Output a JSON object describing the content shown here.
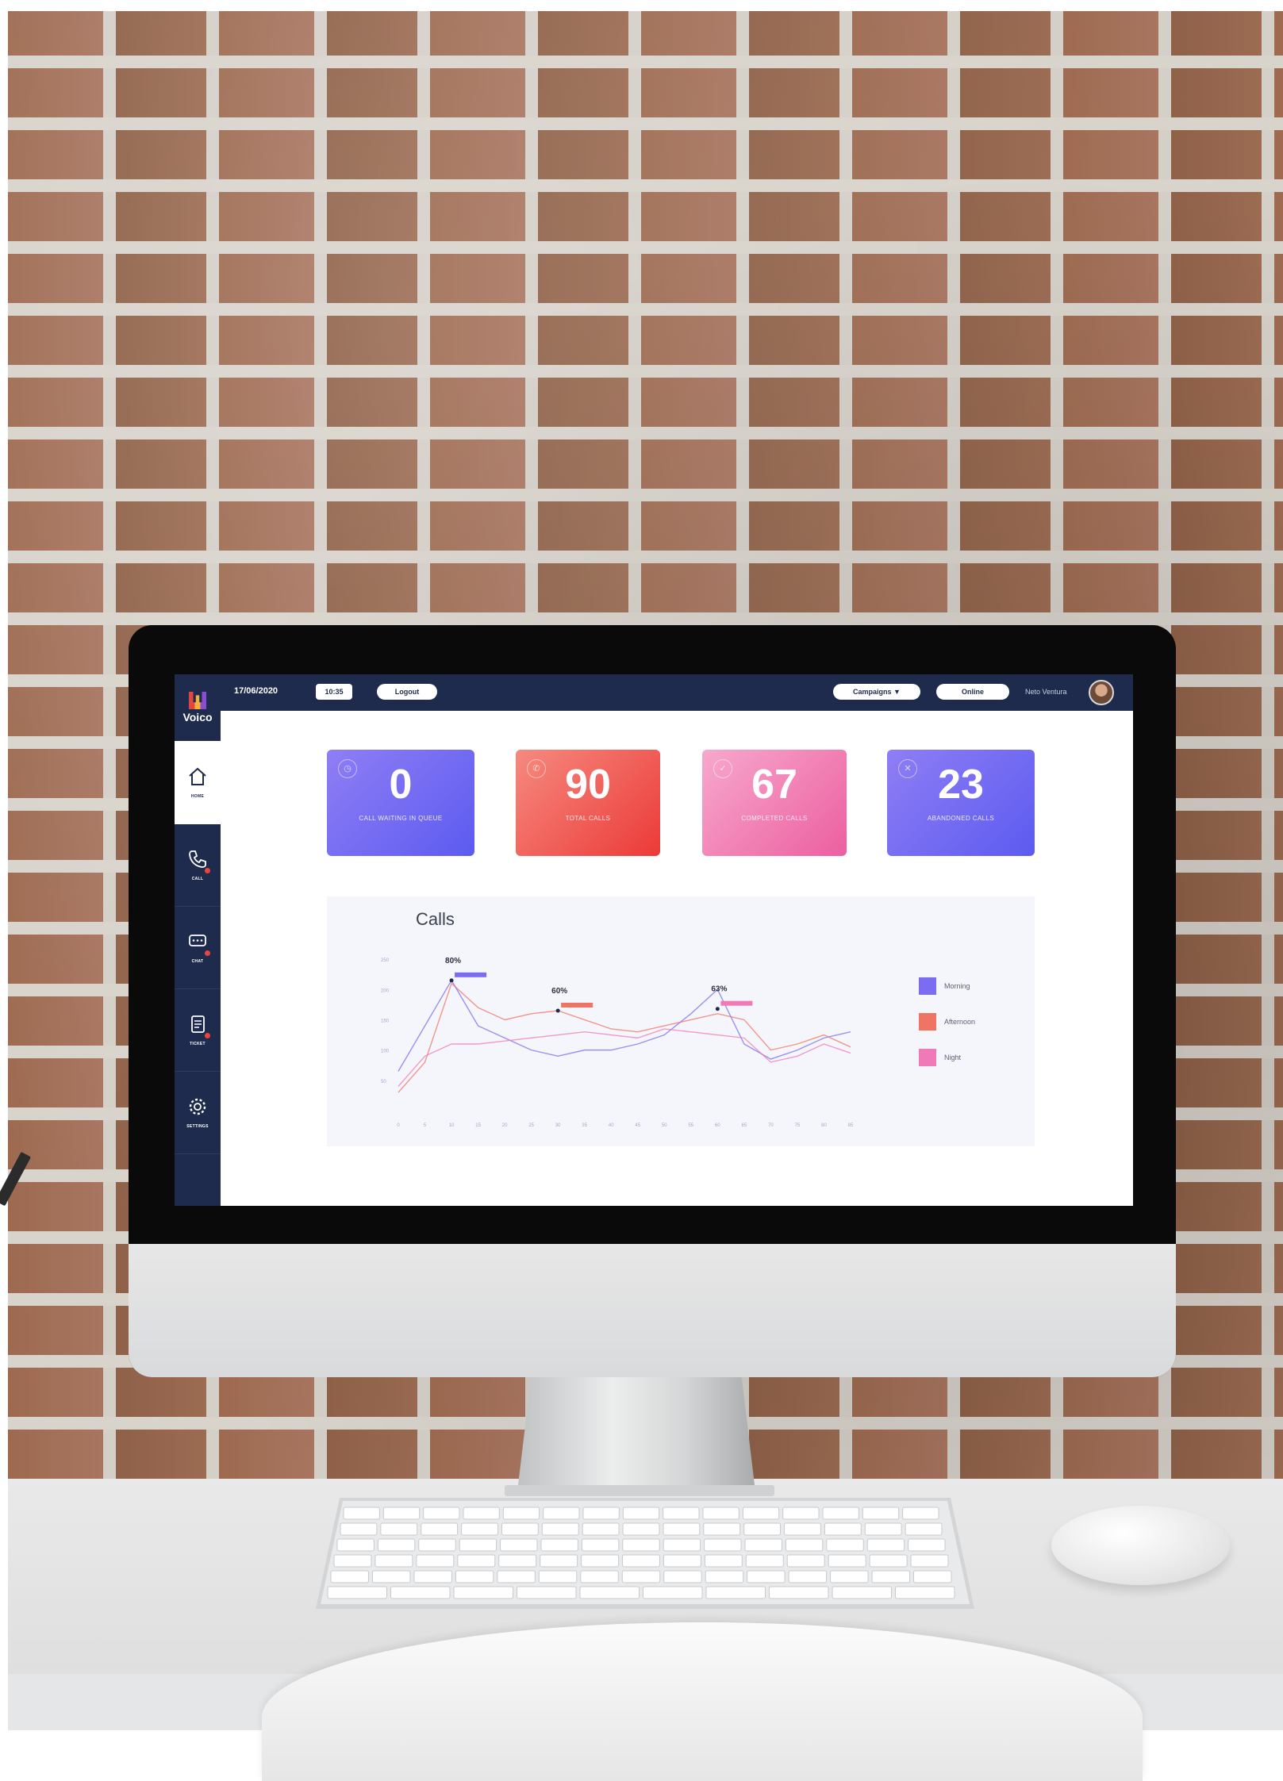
{
  "topbar": {
    "date": "17/06/2020",
    "time": "10:35",
    "logout_label": "Logout",
    "campaigns_label": "Campaigns ▼",
    "status_label": "Online",
    "user_name": "Neto Ventura"
  },
  "sidebar": {
    "logo_text": "Voico",
    "items": [
      {
        "label": "HOME",
        "icon": "home-icon"
      },
      {
        "label": "CALL",
        "icon": "phone-icon"
      },
      {
        "label": "CHAT",
        "icon": "chat-icon"
      },
      {
        "label": "TICKET",
        "icon": "ticket-icon"
      },
      {
        "label": "SETTINGS",
        "icon": "gear-icon"
      }
    ]
  },
  "stats": [
    {
      "value": "0",
      "label": "CALL WAITING IN QUEUE"
    },
    {
      "value": "90",
      "label": "TOTAL CALLS"
    },
    {
      "value": "67",
      "label": "COMPLETED CALLS"
    },
    {
      "value": "23",
      "label": "ABANDONED CALLS"
    }
  ],
  "colors": {
    "navy": "#1e2b4d",
    "morning": "#7b6cf2",
    "afternoon": "#f07464",
    "night": "#f07ab8"
  },
  "chart_data": {
    "type": "line",
    "title": "Calls",
    "x": [
      0,
      5,
      10,
      15,
      20,
      25,
      30,
      35,
      40,
      45,
      50,
      55,
      60,
      65,
      70,
      75,
      80,
      85
    ],
    "yticks": [
      50,
      100,
      150,
      200,
      250
    ],
    "ylim": [
      0,
      275
    ],
    "annotations": [
      {
        "label": "80%",
        "x": 10,
        "y": 215,
        "color": "#7b6cf2"
      },
      {
        "label": "60%",
        "x": 30,
        "y": 165,
        "color": "#f07464"
      },
      {
        "label": "63%",
        "x": 60,
        "y": 168,
        "color": "#f07ab8"
      }
    ],
    "series": [
      {
        "name": "Morning",
        "color": "#7b6cf2",
        "values": [
          65,
          140,
          215,
          140,
          120,
          100,
          90,
          100,
          100,
          110,
          125,
          160,
          200,
          110,
          85,
          100,
          120,
          130
        ]
      },
      {
        "name": "Afternoon",
        "color": "#f07464",
        "values": [
          30,
          80,
          210,
          170,
          150,
          160,
          165,
          150,
          135,
          130,
          140,
          150,
          160,
          150,
          100,
          110,
          125,
          105
        ]
      },
      {
        "name": "Night",
        "color": "#f07ab8",
        "values": [
          40,
          90,
          110,
          110,
          115,
          120,
          125,
          130,
          125,
          120,
          135,
          130,
          125,
          120,
          80,
          90,
          110,
          95
        ]
      }
    ],
    "legend_position": "right"
  }
}
